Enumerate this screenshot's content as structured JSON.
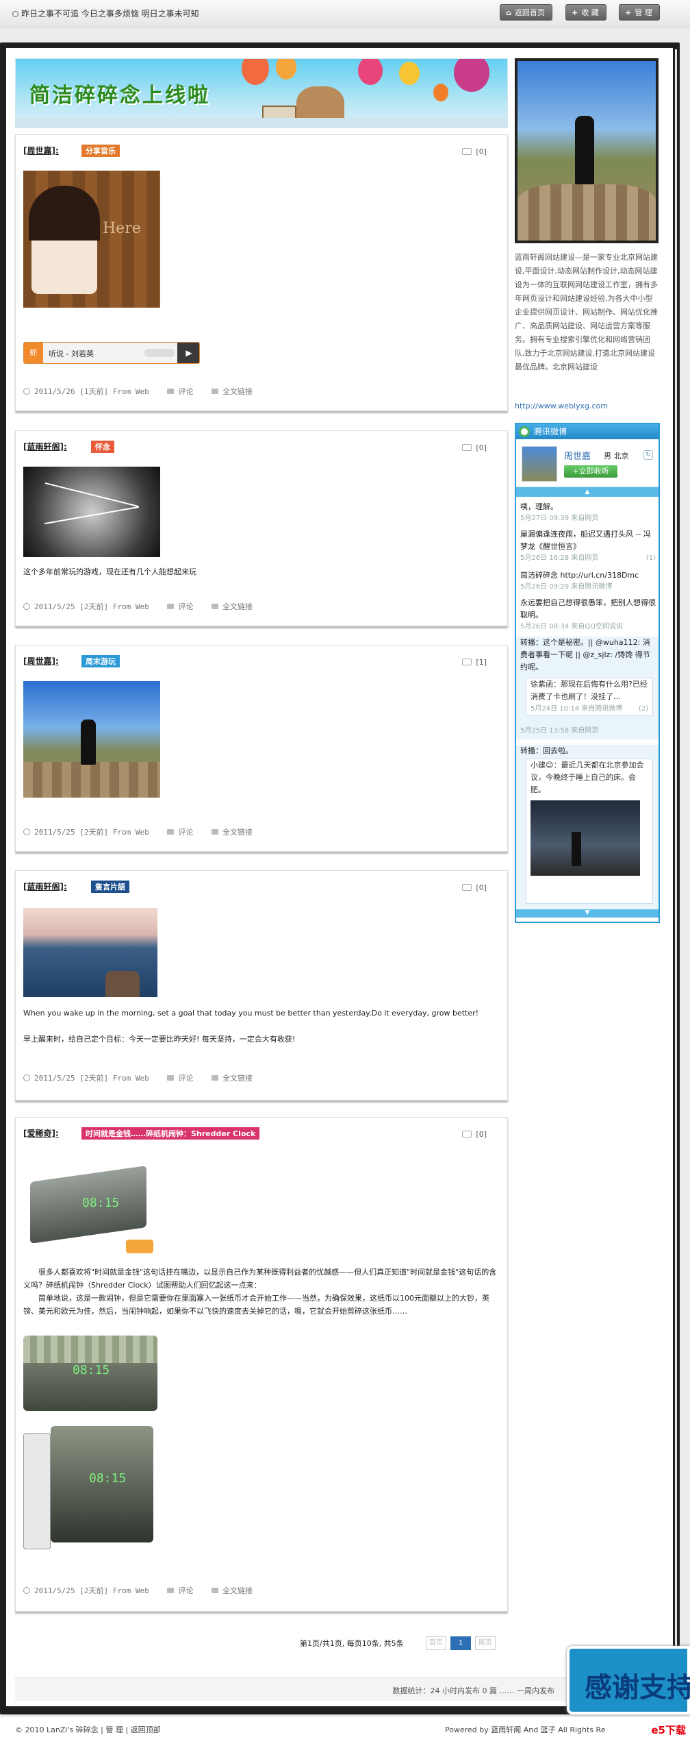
{
  "topbar": {
    "motto": "昨日之事不可追 今日之事多烦恼 明日之事未可知",
    "buttons": [
      "返回首页",
      "收 藏",
      "管 理"
    ]
  },
  "banner": {
    "title": "简洁碎碎念上线啦"
  },
  "posts": [
    {
      "author": "[周世嘉]:",
      "tag": "分享音乐",
      "tag_color": "#e2792b",
      "comments": "[0]",
      "player": {
        "song": "听说 - 刘若英"
      },
      "meta": {
        "date": "2011/5/26 [1天前] From Web",
        "comment": "评论",
        "full": "全文链接"
      }
    },
    {
      "author": "[蓝雨轩阁]:",
      "tag": "怀念",
      "tag_color": "#e85b3a",
      "comments": "[0]",
      "text": "这个多年前常玩的游戏，现在还有几个人能想起来玩",
      "meta": {
        "date": "2011/5/25 [2天前] From Web",
        "comment": "评论",
        "full": "全文链接"
      }
    },
    {
      "author": "[周世嘉]:",
      "tag": "周末游玩",
      "tag_color": "#2a99d6",
      "comments": "[1]",
      "meta": {
        "date": "2011/5/25 [2天前] From Web",
        "comment": "评论",
        "full": "全文链接"
      }
    },
    {
      "author": "[蓝雨轩阁]:",
      "tag": "隻言片語",
      "tag_color": "#1e4f8d",
      "comments": "[0]",
      "text1": "When you wake up in the morning, set a goal that today you must be better than yesterday.Do it everyday, grow better!",
      "text2": "早上醒来时，给自己定个目标：今天一定要比昨天好! 每天坚持，一定会大有收获!",
      "meta": {
        "date": "2011/5/25 [2天前] From Web",
        "comment": "评论",
        "full": "全文链接"
      }
    },
    {
      "author": "[爱稀奇]:",
      "tag": "时间就是金钱……碎纸机闹钟：Shredder Clock",
      "tag_color": "#d8336b",
      "comments": "[0]",
      "para1": "很多人都喜欢将\"时间就是金钱\"这句话挂在嘴边，以显示自己作为某种既得利益者的忧越感——但人们真正知道\"时间就是金钱\"这句话的含义吗？碎纸机闹钟（Shredder Clock）试图帮助人们回忆起这一点来：",
      "para2": "简单地说，这是一款闹钟，但是它需要你在里面塞入一张纸币才会开始工作——当然，为确保效果，这纸币以100元面额以上的大钞，英镑、美元和欧元为佳，然后，当闹钟响起，如果你不以飞快的速度去关掉它的话，嗯，它就会开始剪碎这张纸币……",
      "meta": {
        "date": "2011/5/25 [2天前] From Web",
        "comment": "评论",
        "full": "全文链接"
      }
    }
  ],
  "pager": {
    "summary": "第1页/共1页, 每页10条, 共5条",
    "prev": "首页",
    "current": "1",
    "next": "尾页"
  },
  "stats": {
    "text": "数据统计：24 小时内发布 0 篇 …… 一周内发布"
  },
  "thanks": "感谢支持",
  "footer": {
    "left": "© 2010 LanZi's 碎碎念 | 管 理 | 返回顶部",
    "right": "Powered by 蓝雨轩阁 And 篮子 All Rights Re",
    "watermark": "e5下载"
  },
  "sidebar": {
    "desc": "蓝雨轩阁网站建设—是一家专业北京网站建设,平面设计,动态网站制作设计,动态网站建设为一体的互联网网站建设工作室，拥有多年网页设计和网站建设经验,为各大中小型企业提供网页设计、网站制作、网站优化推广、高品质网站建设、网站运营方案等服务。拥有专业搜索引擎优化和网络营销团队,致力于北京网站建设,打造北京网站建设最优品牌。北京网站建设",
    "url": "http://www.weblyxg.com",
    "weibo": {
      "title": "腾讯微博",
      "name": "周世嘉",
      "sex_city": "男 北京",
      "follow": "+立即收听",
      "items": [
        {
          "text": "咦，理解。",
          "when": "5月27日 09:39 来自网页"
        },
        {
          "text": "屋漏偏逢连夜雨，船迟又遇打头风 -- 冯梦龙《醒世恒言》",
          "when": "5月26日 16:28 来自网页",
          "count": "(1)"
        },
        {
          "text": "简洁碎碎念 http://url.cn/318Dmc",
          "when": "5月26日 09:29 来自腾讯微博"
        },
        {
          "text": "永远要把自己想得很愚笨，把别人想得很聪明。",
          "when": "5月26日 08:34 来自QQ空间说说"
        },
        {
          "text": "转播：这个是秘密。|| @wuha112: 消费者事看一下呢 || @z_sjlz: /馋馋 得节约呢。",
          "when": ""
        },
        {
          "text": "徐紫函：那现在后悔有什么用?已经消费了卡也刷了！没挂了…",
          "when": "5月24日 10:14 来自腾讯微博",
          "count": "(2)"
        },
        {
          "text": "",
          "when": "5月25日 13:58 来自网页"
        },
        {
          "text": "转播：回去啦。",
          "when": ""
        },
        {
          "text": "小建😊：最近几天都在北京参加会议，今晚终于睡上自己的床。会肥。",
          "when": ""
        }
      ]
    }
  }
}
